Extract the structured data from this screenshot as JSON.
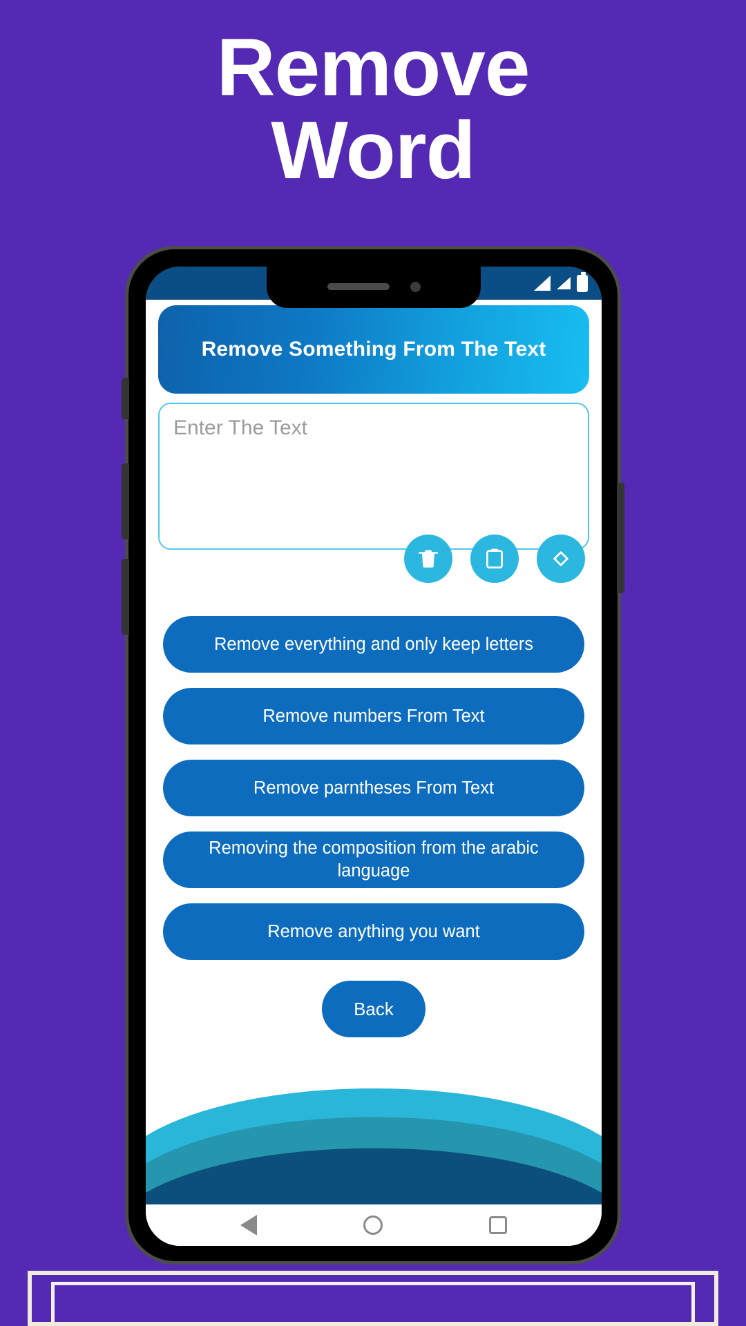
{
  "promo": {
    "title_line1": "Remove",
    "title_line2": "Word",
    "background_color": "#5429b3",
    "title_color": "#ffffff"
  },
  "phone": {
    "frame_color": "#000000",
    "bezel_color": "#4c4c4c",
    "side_buttons": [
      {
        "name": "mute-switch"
      },
      {
        "name": "volume-up"
      },
      {
        "name": "volume-down"
      },
      {
        "name": "power"
      }
    ],
    "notch": {
      "speaker": "earpiece-speaker",
      "camera": "front-camera"
    }
  },
  "status_bar": {
    "background_color": "#0b4e85",
    "icons": [
      {
        "name": "signal-icon-1",
        "glyph": "signal-triangle"
      },
      {
        "name": "signal-icon-2",
        "glyph": "signal-triangle"
      },
      {
        "name": "battery-icon",
        "glyph": "battery"
      }
    ]
  },
  "app": {
    "header": {
      "title": "Remove Something From The Text",
      "gradient_from": "#0e62ab",
      "gradient_to": "#18bdf2"
    },
    "text_input": {
      "value": "",
      "placeholder": "Enter The Text",
      "border_color": "#53c7ec"
    },
    "icon_buttons": [
      {
        "name": "clear-text-button",
        "icon": "trash-icon",
        "color": "#2bb7e0"
      },
      {
        "name": "paste-button",
        "icon": "clipboard-icon",
        "color": "#2bb7e0"
      },
      {
        "name": "expand-button",
        "icon": "move-arrows-icon",
        "color": "#2bb7e0"
      }
    ],
    "actions": [
      {
        "label": "Remove everything and only keep letters"
      },
      {
        "label": "Remove numbers From Text"
      },
      {
        "label": "Remove parntheses From Text"
      },
      {
        "label": "Removing the composition from the arabic language"
      },
      {
        "label": "Remove anything you want"
      }
    ],
    "action_button_color": "#0d6cbe",
    "back_button": {
      "label": "Back"
    },
    "waves": {
      "light": "#29b6d8",
      "mid": "#2596ad",
      "dark": "#0d4f7c"
    }
  },
  "nav_bar": {
    "items": [
      {
        "name": "android-back-button",
        "icon": "triangle-left-icon"
      },
      {
        "name": "android-home-button",
        "icon": "circle-icon"
      },
      {
        "name": "android-recents-button",
        "icon": "square-icon"
      }
    ],
    "icon_color": "#8a8a8a"
  },
  "bottom_card": {
    "outer_color": "#efebdd",
    "inner_color": "#5429b3",
    "frame_color": "#f4eef5"
  }
}
